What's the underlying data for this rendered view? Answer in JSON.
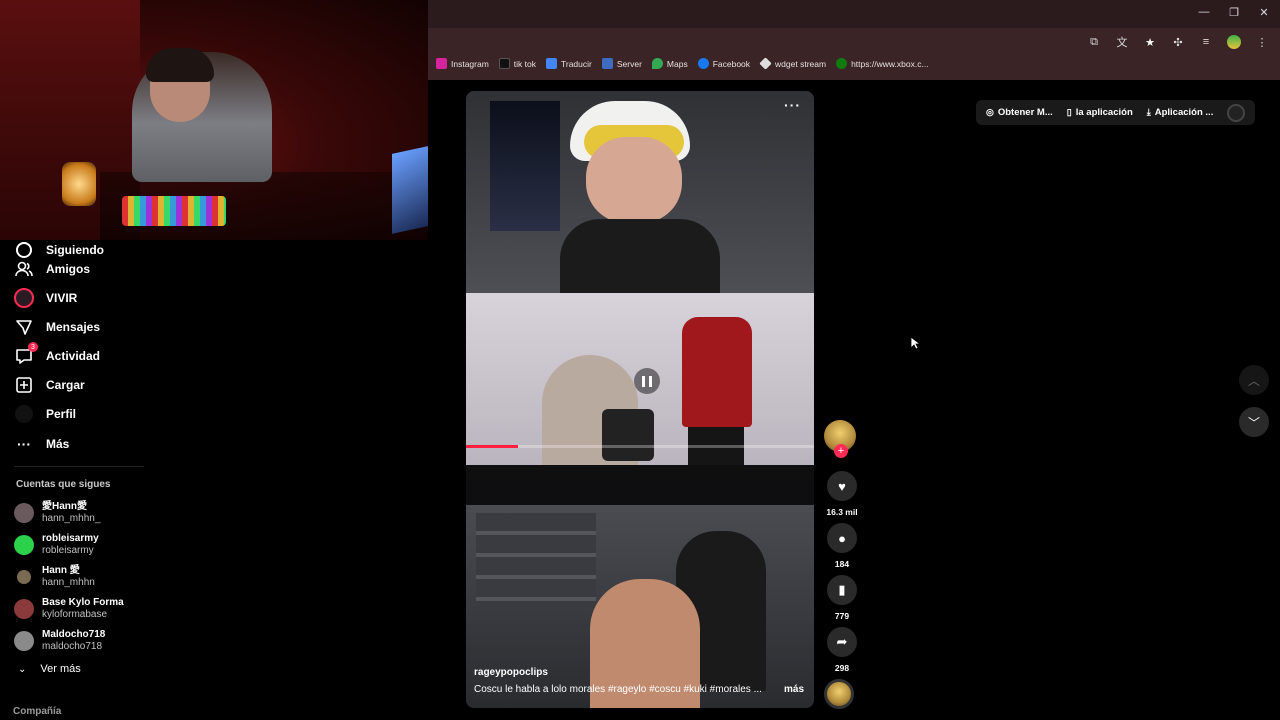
{
  "sidebar": {
    "nav": [
      {
        "label": "Siguiendo",
        "icon": "following-icon"
      },
      {
        "label": "Amigos",
        "icon": "friends-icon"
      },
      {
        "label": "VIVIR",
        "icon": "live-icon"
      },
      {
        "label": "Mensajes",
        "icon": "messages-icon"
      },
      {
        "label": "Actividad",
        "icon": "activity-icon",
        "badge": "3"
      },
      {
        "label": "Cargar",
        "icon": "upload-icon"
      },
      {
        "label": "Perfil",
        "icon": "profile-icon"
      },
      {
        "label": "Más",
        "icon": "more-icon"
      }
    ],
    "following_title": "Cuentas que sigues",
    "following": [
      {
        "name": "愛Hann愛",
        "handle": "hann_mhhn_",
        "color": "#6a5a5e"
      },
      {
        "name": "robleisarmy",
        "handle": "robleisarmy",
        "color": "#2bd14b"
      },
      {
        "name": "Hann 愛",
        "handle": "hann_mhhn",
        "color": "#7a6a52"
      },
      {
        "name": "Base Kylo Forma",
        "handle": "kyloformabase",
        "color": "#8a3a3a"
      },
      {
        "name": "Maldocho718",
        "handle": "maldocho718",
        "color": "#8a8a8a"
      }
    ],
    "ver_mas": "Ver más",
    "company": "Compañía"
  },
  "browser": {
    "bookmarks": [
      {
        "label": "Instagram",
        "color": "#d6249f"
      },
      {
        "label": "tik tok",
        "color": "#111111"
      },
      {
        "label": "Traducir",
        "color": "#4285f4"
      },
      {
        "label": "Server",
        "color": "#3d6cc0"
      },
      {
        "label": "Maps",
        "color": "#34a853"
      },
      {
        "label": "Facebook",
        "color": "#1877f2"
      },
      {
        "label": "wdget stream",
        "color": "#dddddd"
      },
      {
        "label": "https://www.xbox.c...",
        "color": "#107c10"
      }
    ]
  },
  "topbar": {
    "get_label": "Obtener M...",
    "app_label": "la aplicación",
    "app2_label": "Aplicación ..."
  },
  "video": {
    "author": "rageypopoclips",
    "description": "Coscu le habla a lolo morales #rageylo  #coscu  #kuki  #morales ...",
    "more": "más",
    "likes": "16.3 mil",
    "comments": "184",
    "saves": "779",
    "shares": "298",
    "progress": 0.15
  }
}
